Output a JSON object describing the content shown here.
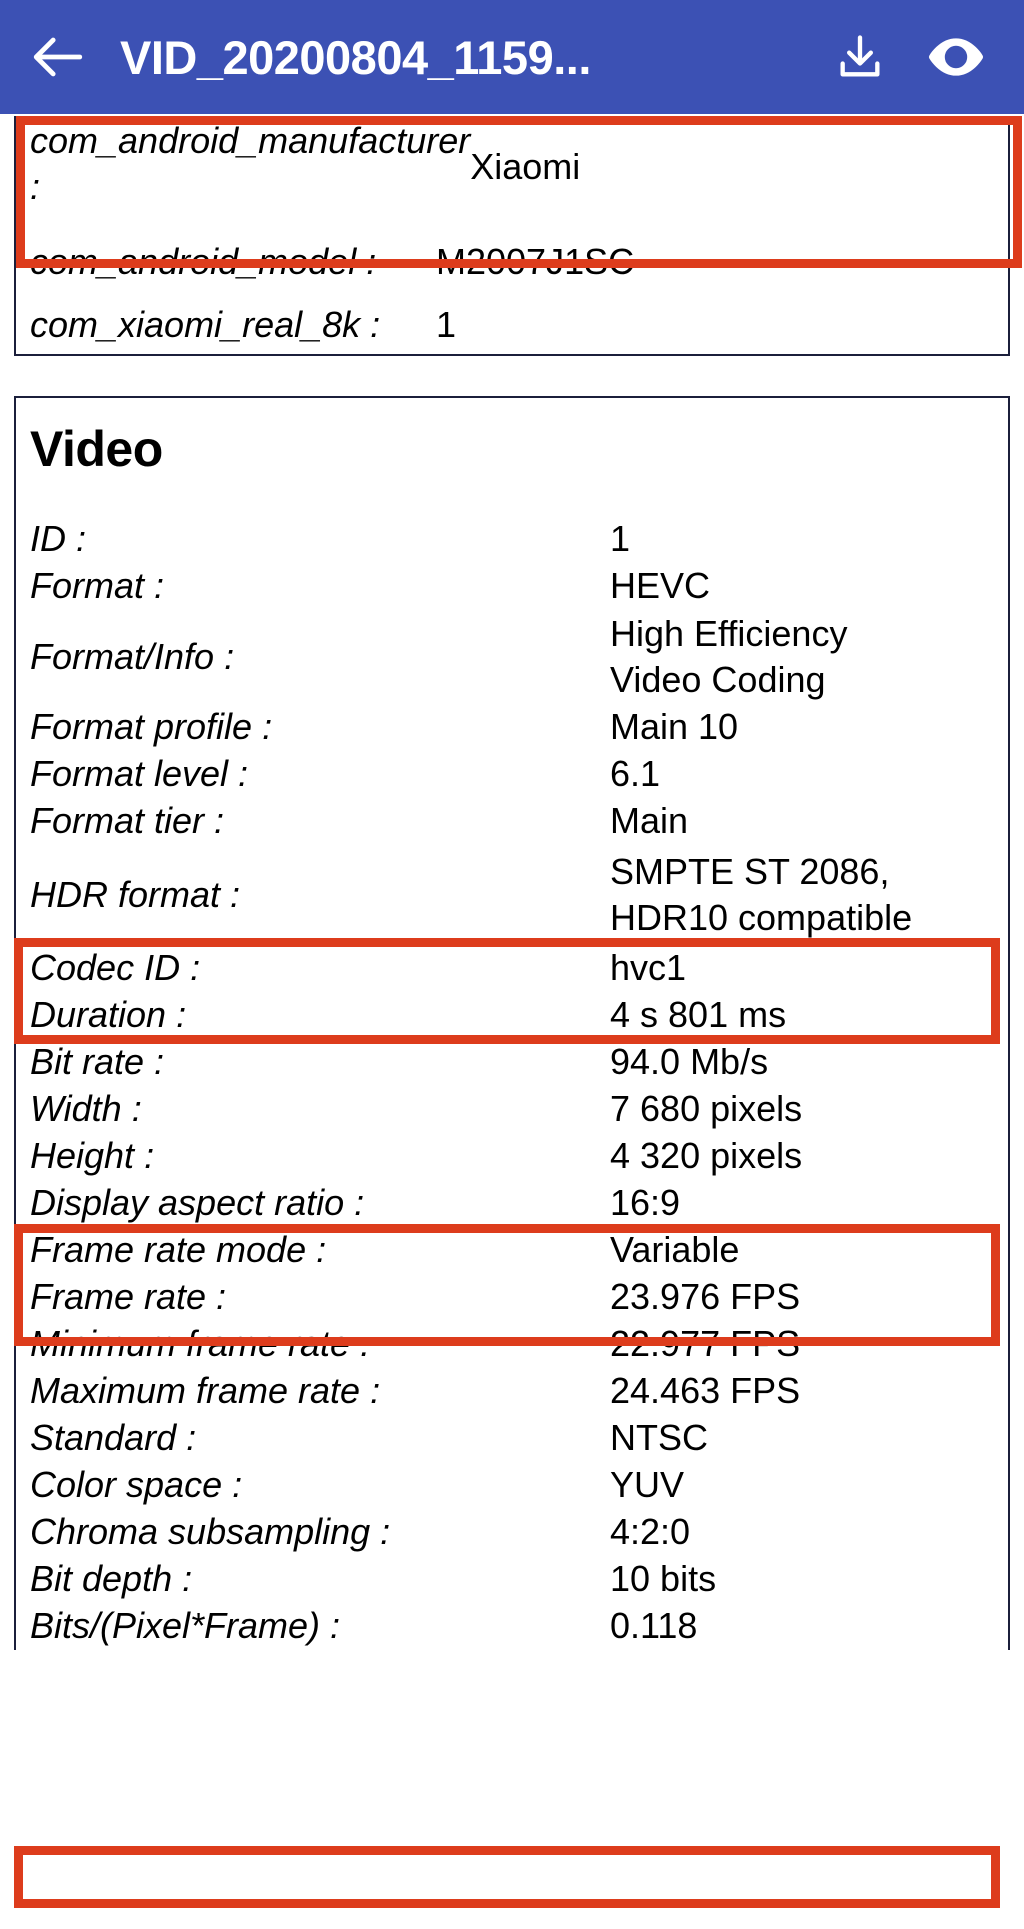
{
  "appbar": {
    "back_icon": "arrow-left-icon",
    "title": "VID_20200804_1159...",
    "download_icon": "download-icon",
    "view_icon": "eye-icon",
    "background_color": "#3c51b4"
  },
  "highlight": {
    "color": "#dd3c1c"
  },
  "cards": [
    {
      "title": "",
      "rows": [
        {
          "label": "com_android_manufacturer :",
          "value": "Xiaomi"
        },
        {
          "label": "com_android_model :",
          "value": "M2007J1SC"
        },
        {
          "label": "com_xiaomi_real_8k :",
          "value": "1"
        }
      ]
    },
    {
      "title": "Video",
      "rows": [
        {
          "label": "ID :",
          "value": "1"
        },
        {
          "label": "Format :",
          "value": "HEVC"
        },
        {
          "label": "Format/Info :",
          "value_line1": "High Efficiency",
          "value_line2": "Video Coding"
        },
        {
          "label": "Format profile :",
          "value": "Main 10"
        },
        {
          "label": "Format level :",
          "value": "6.1"
        },
        {
          "label": "Format tier :",
          "value": "Main"
        },
        {
          "label": "HDR format :",
          "value_line1": "SMPTE ST 2086,",
          "value_line2": "HDR10 compatible"
        },
        {
          "label": "Codec ID :",
          "value": "hvc1"
        },
        {
          "label": "Duration :",
          "value": "4 s 801 ms"
        },
        {
          "label": "Bit rate :",
          "value": "94.0 Mb/s"
        },
        {
          "label": "Width :",
          "value": "7 680 pixels"
        },
        {
          "label": "Height :",
          "value": "4 320 pixels"
        },
        {
          "label": "Display aspect ratio :",
          "value": "16:9"
        },
        {
          "label": "Frame rate mode :",
          "value": "Variable"
        },
        {
          "label": "Frame rate :",
          "value": "23.976 FPS"
        },
        {
          "label": "Minimum frame rate :",
          "value": "22.977 FPS"
        },
        {
          "label": "Maximum frame rate :",
          "value": "24.463 FPS"
        },
        {
          "label": "Standard :",
          "value": "NTSC"
        },
        {
          "label": "Color space :",
          "value": "YUV"
        },
        {
          "label": "Chroma subsampling :",
          "value": "4:2:0"
        },
        {
          "label": "Bit depth :",
          "value": "10 bits"
        },
        {
          "label": "Bits/(Pixel*Frame) :",
          "value": "0.118"
        }
      ]
    }
  ]
}
